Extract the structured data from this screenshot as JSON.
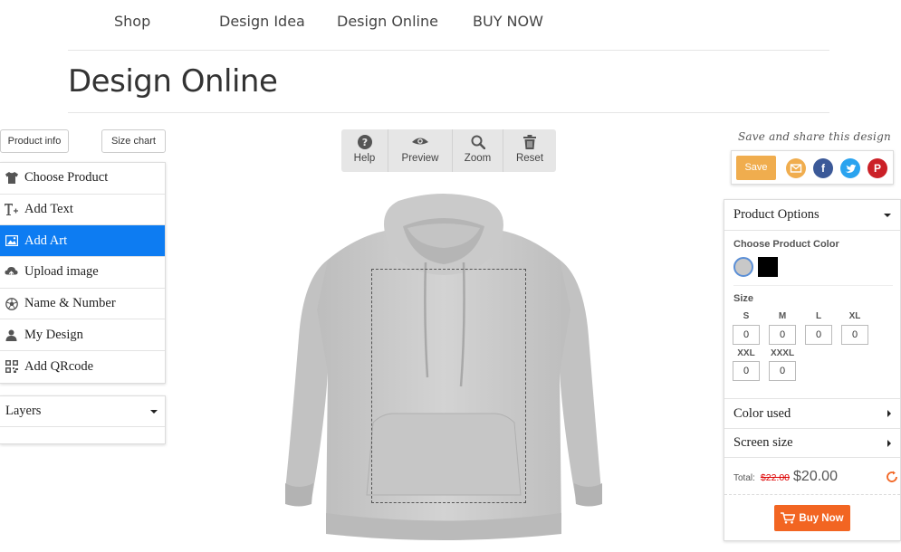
{
  "nav": {
    "items": [
      "Shop",
      "Design Idea",
      "Design Online",
      "BUY NOW"
    ]
  },
  "page_title": "Design Online",
  "left": {
    "product_info_label": "Product info",
    "size_chart_label": "Size chart",
    "tools": [
      {
        "label": "Choose Product",
        "icon": "tshirt-icon"
      },
      {
        "label": "Add Text",
        "icon": "text-icon"
      },
      {
        "label": "Add Art",
        "icon": "image-icon"
      },
      {
        "label": "Upload image",
        "icon": "cloud-upload-icon"
      },
      {
        "label": "Name & Number",
        "icon": "soccer-ball-icon"
      },
      {
        "label": "My Design",
        "icon": "user-icon"
      },
      {
        "label": "Add QRcode",
        "icon": "qrcode-icon"
      }
    ],
    "active_tool": "Add Art",
    "layers_label": "Layers"
  },
  "toolbar": {
    "help": "Help",
    "preview": "Preview",
    "zoom": "Zoom",
    "reset": "Reset"
  },
  "share": {
    "title": "Save and share this design",
    "save_label": "Save",
    "icons": [
      "email-icon",
      "facebook-icon",
      "twitter-icon",
      "pinterest-icon"
    ]
  },
  "options": {
    "header": "Product Options",
    "color_label": "Choose Product Color",
    "colors": [
      "#c8c8c8",
      "#000000"
    ],
    "selected_color": "#c8c8c8",
    "size_label": "Size",
    "sizes": [
      {
        "name": "S",
        "qty": "0"
      },
      {
        "name": "M",
        "qty": "0"
      },
      {
        "name": "L",
        "qty": "0"
      },
      {
        "name": "XL",
        "qty": "0"
      },
      {
        "name": "XXL",
        "qty": "0"
      },
      {
        "name": "XXXL",
        "qty": "0"
      }
    ],
    "color_used_label": "Color used",
    "screen_size_label": "Screen size",
    "total_label": "Total:",
    "old_price": "$22.00",
    "price": "$20.00",
    "buy_now_label": "Buy Now"
  },
  "colors": {
    "accent_blue": "#0d7cf2",
    "save_orange": "#f0ad4e",
    "buy_orange": "#f26522"
  }
}
